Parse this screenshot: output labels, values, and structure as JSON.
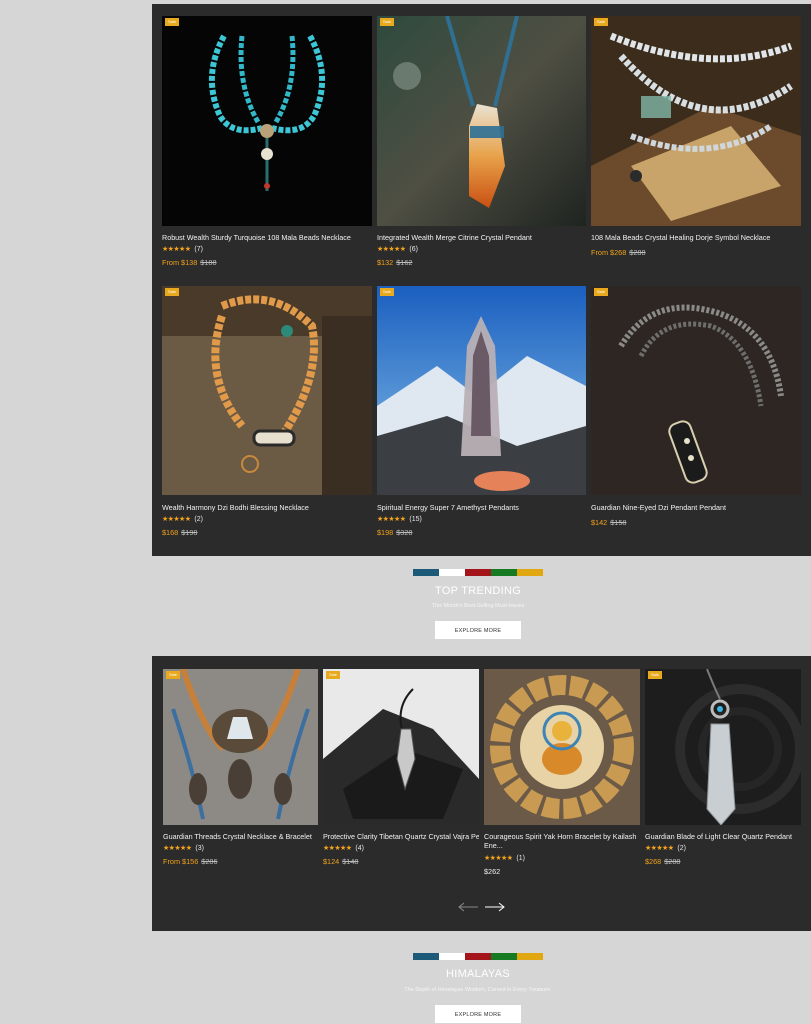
{
  "colors": {
    "accent": "#f3a31d",
    "badge": "#e9a91f",
    "panel": "#2b2b2b",
    "background": "#d6d6d6"
  },
  "badge_label": "Sale",
  "grid_products": [
    {
      "title": "Robust Wealth Sturdy Turquoise 108 Mala Beads Necklace",
      "stars": "★★★★★",
      "reviews": "(7)",
      "price": "From $138",
      "old_price": "$188"
    },
    {
      "title": "Integrated Wealth Merge Citrine Crystal Pendant",
      "stars": "★★★★★",
      "reviews": "(6)",
      "price": "$132",
      "old_price": "$162"
    },
    {
      "title": "108 Mala Beads Crystal Healing Dorje Symbol Necklace",
      "stars": "",
      "reviews": "",
      "price": "From $268",
      "old_price": "$288"
    },
    {
      "title": "Wealth Harmony Dzi Bodhi Blessing Necklace",
      "stars": "★★★★★",
      "reviews": "(2)",
      "price": "$168",
      "old_price": "$198"
    },
    {
      "title": "Spiritual Energy Super 7 Amethyst Pendants",
      "stars": "★★★★★",
      "reviews": "(15)",
      "price": "$198",
      "old_price": "$328"
    },
    {
      "title": "Guardian Nine-Eyed Dzi Pendant Pendant",
      "stars": "",
      "reviews": "",
      "price": "$142",
      "old_price": "$158"
    }
  ],
  "stripe_colors": [
    "#1d5a7a",
    "#ffffff",
    "#a3141b",
    "#167a23",
    "#e0a711"
  ],
  "top_trending": {
    "title": "TOP TRENDING",
    "subtitle": "This Month's Best-Selling Must-Haves",
    "button": "EXPLORE MORE"
  },
  "trending_products": [
    {
      "title": "Guardian Threads Crystal Necklace & Bracelet",
      "stars": "★★★★★",
      "reviews": "(3)",
      "price": "From $156",
      "old_price": "$286"
    },
    {
      "title": "Protective Clarity Tibetan Quartz Crystal Vajra Pe...",
      "stars": "★★★★★",
      "reviews": "(4)",
      "price": "$124",
      "old_price": "$148"
    },
    {
      "title": "Courageous Spirit Yak Horn Bracelet by Kailash Ene...",
      "stars": "★★★★★",
      "reviews": "(1)",
      "price": "$262",
      "old_price": ""
    },
    {
      "title": "Guardian Blade of Light Clear Quartz Pendant",
      "stars": "★★★★★",
      "reviews": "(2)",
      "price": "$268",
      "old_price": "$288"
    }
  ],
  "carousel": {
    "prev_icon": "arrow-left-icon",
    "next_icon": "arrow-right-icon"
  },
  "himalayas": {
    "title": "HIMALAYAS",
    "subtitle": "The Depth of Himalayas Wisdom, Carved in Every Treasure.",
    "button": "EXPLORE MORE"
  }
}
